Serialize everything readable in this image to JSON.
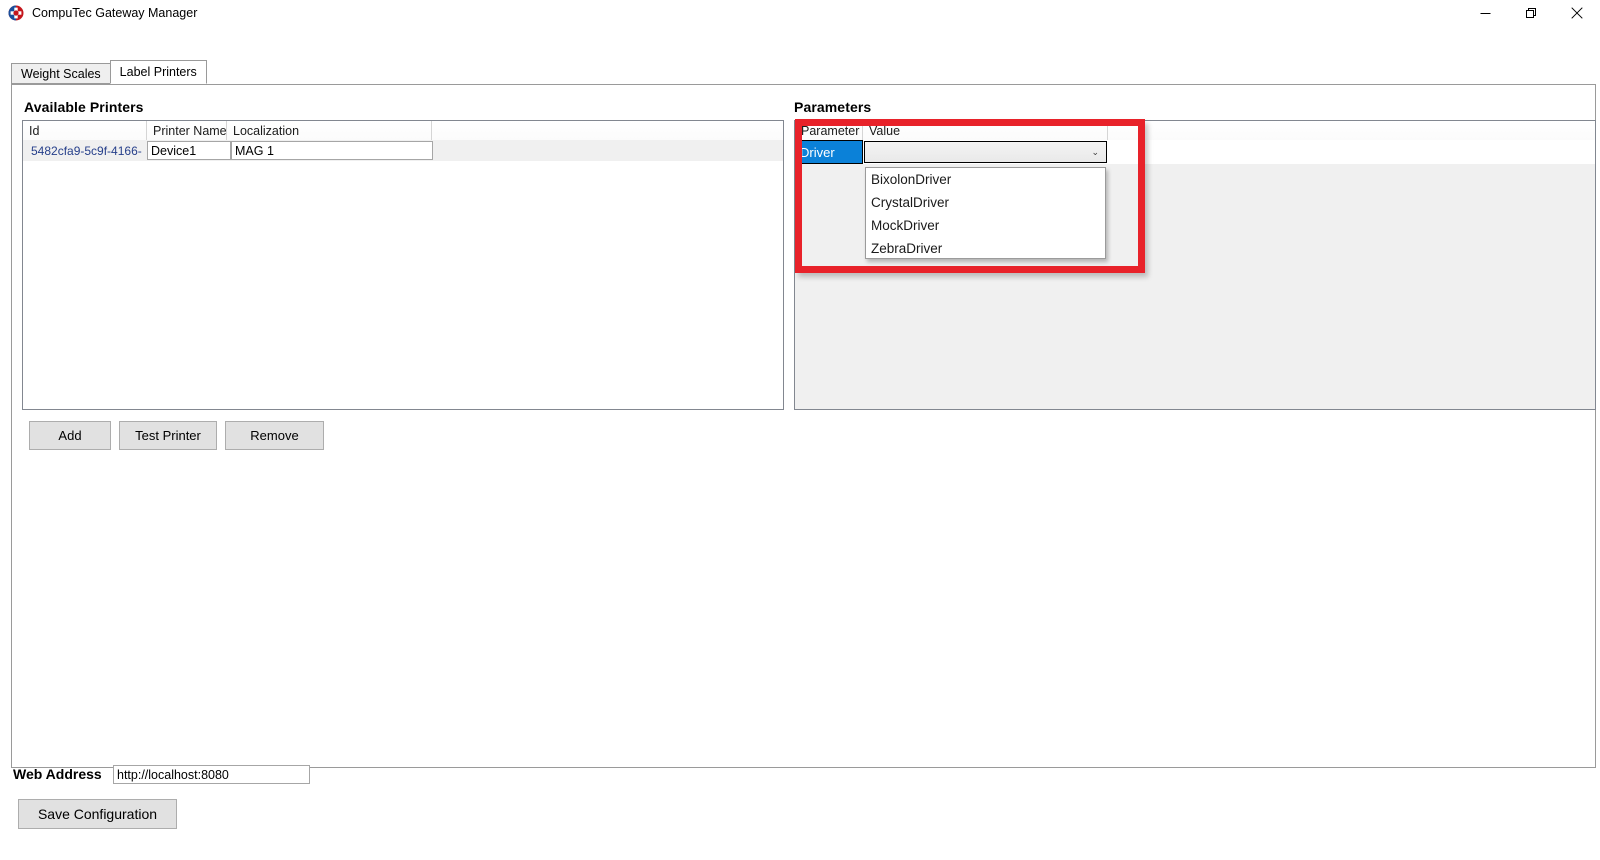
{
  "window": {
    "title": "CompuTec Gateway Manager",
    "logo_icon": "computec-logo-icon",
    "controls": {
      "minimize": "minimize-icon",
      "restore": "restore-icon",
      "close": "close-icon"
    }
  },
  "tabs": [
    {
      "label": "Weight Scales",
      "active": false
    },
    {
      "label": "Label Printers",
      "active": true
    }
  ],
  "printers": {
    "section_title": "Available Printers",
    "columns": [
      "Id",
      "Printer Name",
      "Localization",
      ""
    ],
    "rows": [
      {
        "id": "5482cfa9-5c9f-4166-",
        "printer_name": "Device1",
        "localization": "MAG 1"
      }
    ],
    "buttons": {
      "add": "Add",
      "test": "Test Printer",
      "remove": "Remove"
    }
  },
  "parameters": {
    "section_title": "Parameters",
    "columns": [
      "Parameter",
      "Value",
      ""
    ],
    "rows": [
      {
        "parameter": "Driver",
        "value": "",
        "selected": true
      }
    ],
    "dropdown": {
      "open": true,
      "chevron": "⌄",
      "options": [
        "BixolonDriver",
        "CrystalDriver",
        "MockDriver",
        "ZebraDriver"
      ]
    }
  },
  "annotation": {
    "type": "highlight-rectangle",
    "color": "#E8222A"
  },
  "footer": {
    "web_address_label": "Web Address",
    "web_address_value": "http://localhost:8080",
    "web_address_placeholder": "http://localhost:8080",
    "save_label": "Save Configuration"
  },
  "colors": {
    "selection_blue": "#0B81D8",
    "annotation_red": "#E8222A",
    "id_text": "#27408B",
    "button_face": "#E1E1E1",
    "panel_gray": "#F0F0F0"
  }
}
